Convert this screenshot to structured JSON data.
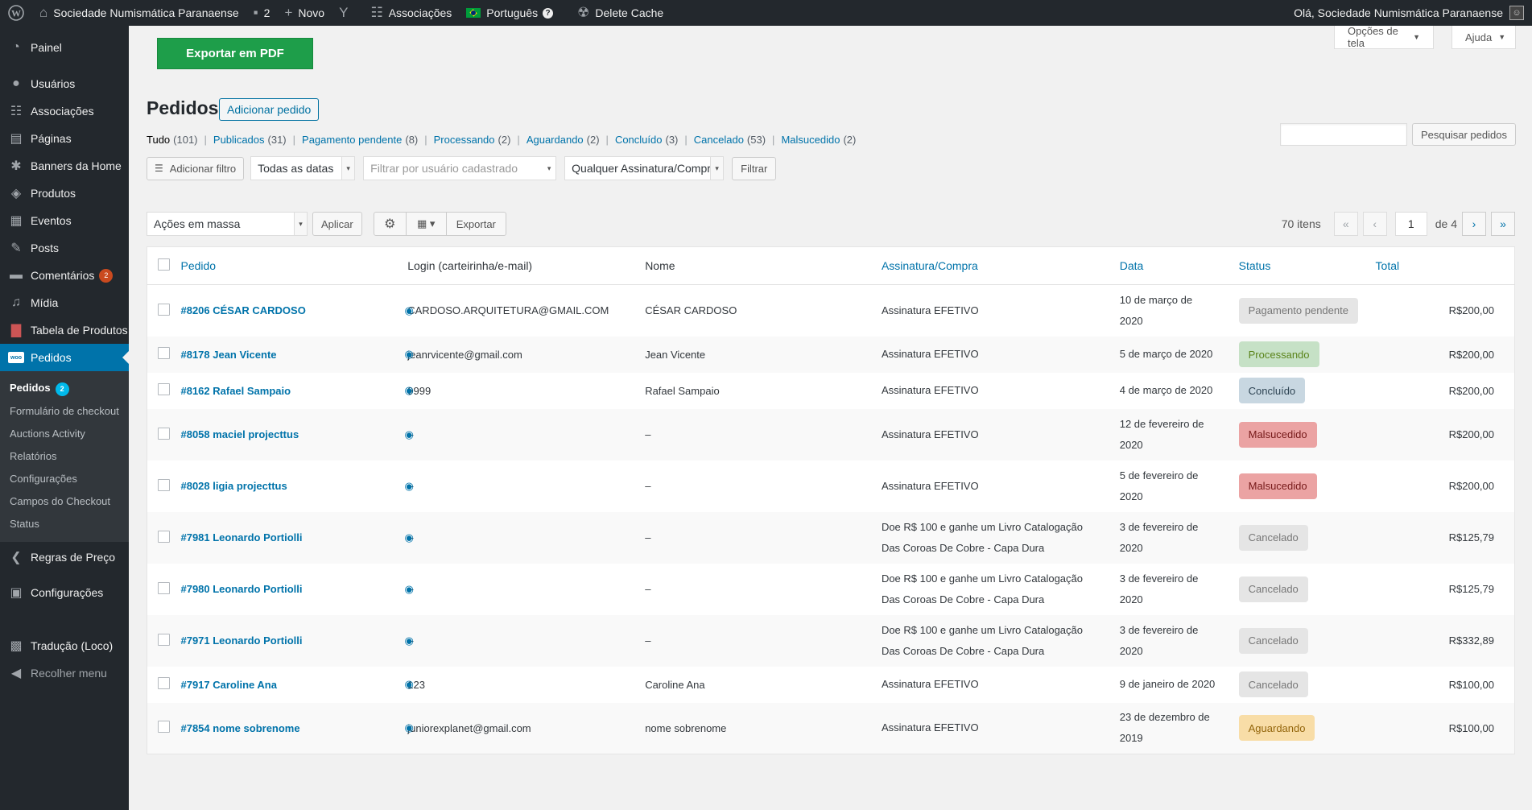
{
  "adminbar": {
    "site_name": "Sociedade Numismática Paranaense",
    "comments_count": "2",
    "new_label": "Novo",
    "associations_label": "Associações",
    "language_label": "Português",
    "delete_cache_label": "Delete Cache",
    "greeting": "Olá, Sociedade Numismática Paranaense"
  },
  "menu": {
    "painel": "Painel",
    "usuarios": "Usuários",
    "associacoes": "Associações",
    "paginas": "Páginas",
    "banners": "Banners da Home",
    "produtos": "Produtos",
    "eventos": "Eventos",
    "posts": "Posts",
    "comentarios": "Comentários",
    "comentarios_badge": "2",
    "midia": "Mídia",
    "tabela": "Tabela de Produtos",
    "pedidos": "Pedidos",
    "woo_icon": "woo",
    "regras": "Regras de Preço",
    "configuracoes": "Configurações",
    "traducao": "Tradução (Loco)",
    "recolher": "Recolher menu",
    "submenu": {
      "pedidos": "Pedidos",
      "pedidos_badge": "2",
      "formulario": "Formulário de checkout",
      "auctions": "Auctions Activity",
      "relatorios": "Relatórios",
      "configuracoes": "Configurações",
      "campos": "Campos do Checkout",
      "status": "Status"
    }
  },
  "header": {
    "export_pdf": "Exportar em PDF",
    "screen_options": "Opções de tela",
    "help": "Ajuda",
    "title": "Pedidos",
    "add_order": "Adicionar pedido"
  },
  "views": [
    {
      "label": "Tudo",
      "count": "(101)"
    },
    {
      "label": "Publicados",
      "count": "(31)"
    },
    {
      "label": "Pagamento pendente",
      "count": "(8)"
    },
    {
      "label": "Processando",
      "count": "(2)"
    },
    {
      "label": "Aguardando",
      "count": "(2)"
    },
    {
      "label": "Concluído",
      "count": "(3)"
    },
    {
      "label": "Cancelado",
      "count": "(53)"
    },
    {
      "label": "Malsucedido",
      "count": "(2)"
    }
  ],
  "search": {
    "button": "Pesquisar pedidos",
    "value": ""
  },
  "filters": {
    "add_filter": "Adicionar filtro",
    "dates": "Todas as datas",
    "user_placeholder": "Filtrar por usuário cadastrado",
    "subscription": "Qualquer Assinatura/Compra",
    "filter_btn": "Filtrar",
    "bulk": "Ações em massa",
    "apply": "Aplicar",
    "export": "Exportar"
  },
  "pagination": {
    "items": "70 itens",
    "first": "«",
    "prev": "‹",
    "current": "1",
    "of": "de 4",
    "next": "›",
    "last": "»"
  },
  "table": {
    "headers": {
      "order": "Pedido",
      "login": "Login (carteirinha/e-mail)",
      "name": "Nome",
      "subscription": "Assinatura/Compra",
      "date": "Data",
      "status": "Status",
      "total": "Total"
    },
    "rows": [
      {
        "order": "#8206 CÉSAR CARDOSO",
        "login": "CARDOSO.ARQUITETURA@GMAIL.COM",
        "name": "CÉSAR CARDOSO",
        "subscription": [
          "Assinatura EFETIVO"
        ],
        "date": [
          "10 de março de",
          "2020"
        ],
        "status": "Pagamento pendente",
        "status_class": "st-pending",
        "total": "R$200,00"
      },
      {
        "order": "#8178 Jean Vicente",
        "login": "jeanrvicente@gmail.com",
        "name": "Jean Vicente",
        "subscription": [
          "Assinatura EFETIVO"
        ],
        "date": [
          "5 de março de 2020"
        ],
        "status": "Processando",
        "status_class": "st-processing",
        "total": "R$200,00"
      },
      {
        "order": "#8162 Rafael Sampaio",
        "login": "9999",
        "name": "Rafael Sampaio",
        "subscription": [
          "Assinatura EFETIVO"
        ],
        "date": [
          "4 de março de 2020"
        ],
        "status": "Concluído",
        "status_class": "st-completed",
        "total": "R$200,00"
      },
      {
        "order": "#8058 maciel projecttus",
        "login": "–",
        "name": "–",
        "subscription": [
          "Assinatura EFETIVO"
        ],
        "date": [
          "12 de fevereiro de",
          "2020"
        ],
        "status": "Malsucedido",
        "status_class": "st-failed",
        "total": "R$200,00"
      },
      {
        "order": "#8028 ligia projecttus",
        "login": "–",
        "name": "–",
        "subscription": [
          "Assinatura EFETIVO"
        ],
        "date": [
          "5 de fevereiro de",
          "2020"
        ],
        "status": "Malsucedido",
        "status_class": "st-failed",
        "total": "R$200,00"
      },
      {
        "order": "#7981 Leonardo Portiolli",
        "login": "–",
        "name": "–",
        "subscription": [
          "Doe R$ 100 e ganhe um Livro Catalogação",
          "Das Coroas De Cobre - Capa Dura"
        ],
        "date": [
          "3 de fevereiro de",
          "2020"
        ],
        "status": "Cancelado",
        "status_class": "st-cancelled",
        "total": "R$125,79"
      },
      {
        "order": "#7980 Leonardo Portiolli",
        "login": "–",
        "name": "–",
        "subscription": [
          "Doe R$ 100 e ganhe um Livro Catalogação",
          "Das Coroas De Cobre - Capa Dura"
        ],
        "date": [
          "3 de fevereiro de",
          "2020"
        ],
        "status": "Cancelado",
        "status_class": "st-cancelled",
        "total": "R$125,79"
      },
      {
        "order": "#7971 Leonardo Portiolli",
        "login": "–",
        "name": "–",
        "subscription": [
          "Doe R$ 100 e ganhe um Livro Catalogação",
          "Das Coroas De Cobre - Capa Dura"
        ],
        "date": [
          "3 de fevereiro de",
          "2020"
        ],
        "status": "Cancelado",
        "status_class": "st-cancelled",
        "total": "R$332,89"
      },
      {
        "order": "#7917 Caroline Ana",
        "login": "123",
        "name": "Caroline Ana",
        "subscription": [
          "Assinatura EFETIVO"
        ],
        "date": [
          "9 de janeiro de 2020"
        ],
        "status": "Cancelado",
        "status_class": "st-cancelled",
        "total": "R$100,00"
      },
      {
        "order": "#7854 nome sobrenome",
        "login": "juniorexplanet@gmail.com",
        "name": "nome sobrenome",
        "subscription": [
          "Assinatura EFETIVO"
        ],
        "date": [
          "23 de dezembro de",
          "2019"
        ],
        "status": "Aguardando",
        "status_class": "st-onhold",
        "total": "R$100,00"
      }
    ]
  }
}
